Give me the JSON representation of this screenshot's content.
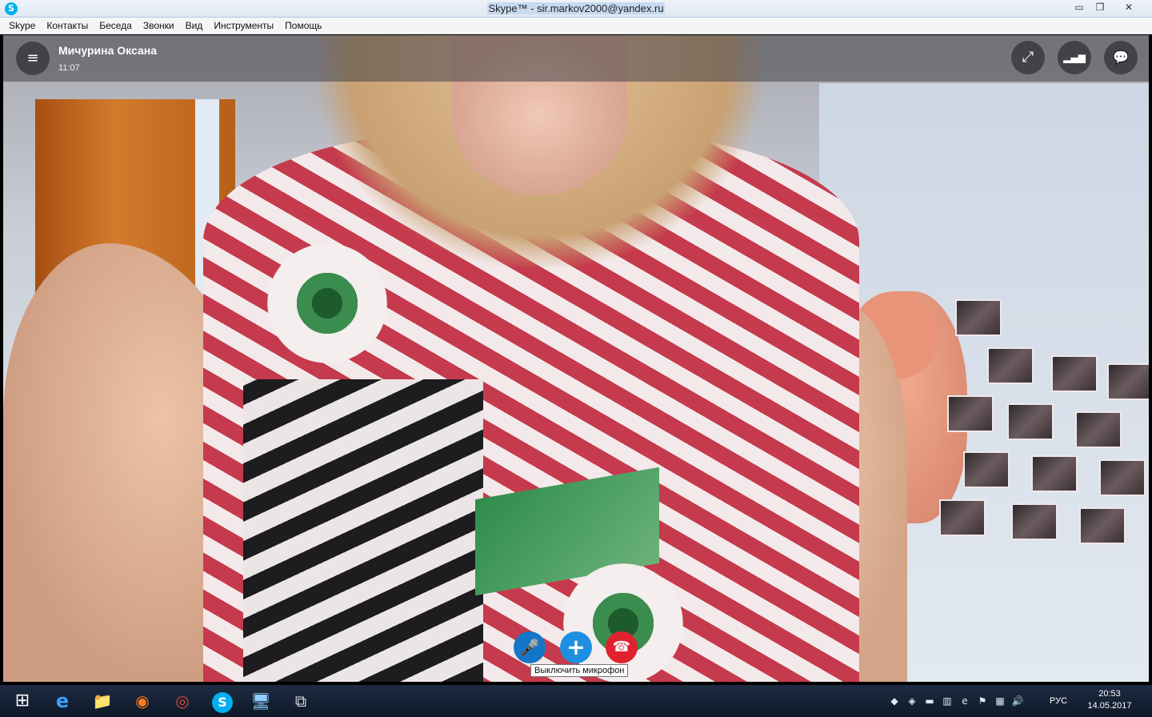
{
  "window": {
    "title": "Skype™ - sir.markov2000@yandex.ru",
    "app_icon": "S",
    "min_glyph": "▭",
    "max_glyph": "❐",
    "close_glyph": "✕"
  },
  "menu": [
    "Skype",
    "Контакты",
    "Беседа",
    "Звонки",
    "Вид",
    "Инструменты",
    "Помощь"
  ],
  "call": {
    "caller_name": "Мичурина Оксана",
    "duration": "11:07",
    "menu_icon": "≡",
    "expand_icon": "⤢",
    "signal_icon": "▂▄▆",
    "chat_icon": "💬"
  },
  "controls": {
    "mic_icon": "🎤",
    "add_icon": "+",
    "end_icon": "☎",
    "mic_tooltip": "Выключить микрофон"
  },
  "taskbar": {
    "start_icon": "⊞",
    "ie_icon": "e",
    "explorer_icon": "📁",
    "firefox_icon": "◉",
    "chrome_icon": "◎",
    "skype_icon": "S",
    "computer_icon": "🖥",
    "rdp_icon": "⧉",
    "tray_icons": [
      "◆",
      "◈",
      "▬",
      "▥",
      "e",
      "⚑",
      "▦",
      "🔊"
    ],
    "language": "РУС",
    "time": "20:53",
    "date": "14.05.2017"
  }
}
